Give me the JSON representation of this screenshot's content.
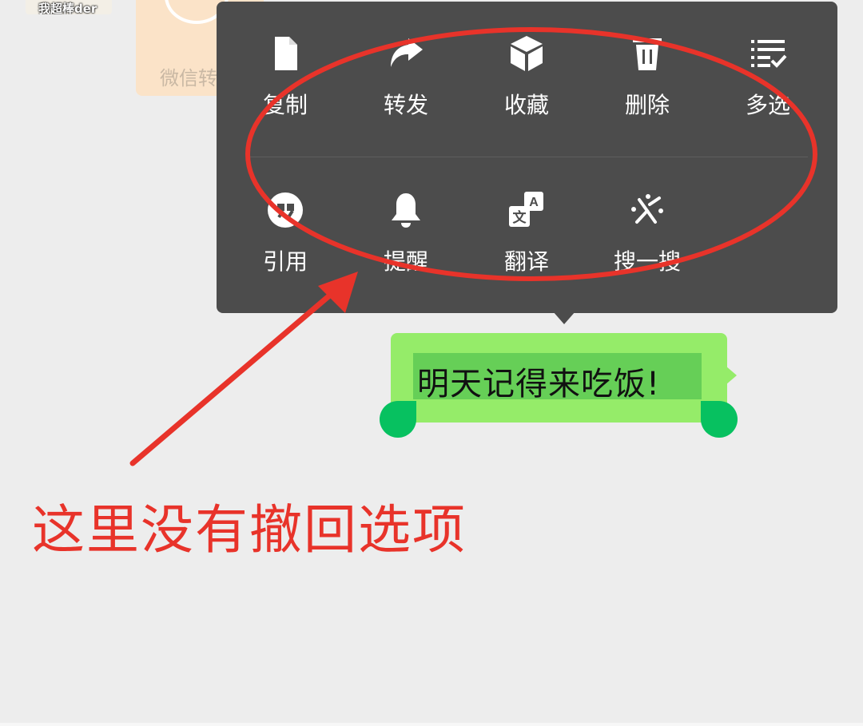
{
  "top_thumbnail": {
    "caption": "我超棒der"
  },
  "previous_card": {
    "label": "微信转"
  },
  "context_menu": {
    "row1": [
      {
        "label": "复制",
        "icon": "copy-icon"
      },
      {
        "label": "转发",
        "icon": "forward-icon"
      },
      {
        "label": "收藏",
        "icon": "favorite-icon"
      },
      {
        "label": "删除",
        "icon": "delete-icon"
      },
      {
        "label": "多选",
        "icon": "multi-select-icon"
      }
    ],
    "row2": [
      {
        "label": "引用",
        "icon": "quote-icon"
      },
      {
        "label": "提醒",
        "icon": "remind-bell-icon"
      },
      {
        "label": "翻译",
        "icon": "translate-icon"
      },
      {
        "label": "搜一搜",
        "icon": "search-sparkle-icon"
      }
    ]
  },
  "message": {
    "text": "明天记得来吃饭!"
  },
  "annotation": {
    "text": "这里没有撤回选项",
    "color": "#e8332a"
  },
  "colors": {
    "menu_bg": "#4c4c4c",
    "bubble_bg": "#95ec69",
    "selection_bg": "#66cf57",
    "handle": "#07c160",
    "page_bg": "#ededed"
  }
}
